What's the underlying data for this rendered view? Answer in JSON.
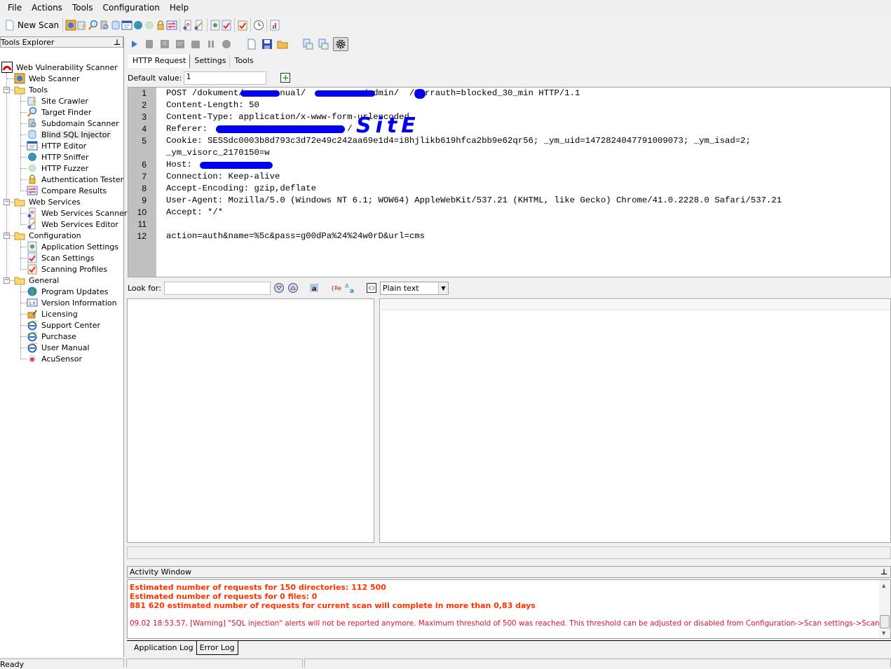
{
  "menu": [
    "File",
    "Actions",
    "Tools",
    "Configuration",
    "Help"
  ],
  "toolbar": {
    "new_scan_label": "New Scan",
    "icons": [
      "web-scanner-icon",
      "site-crawler-icon",
      "target-finder-icon",
      "subdomain-scanner-icon",
      "blind-sql-icon",
      "http-editor-icon",
      "http-sniffer-icon",
      "http-fuzzer-icon",
      "authentication-tester-icon",
      "compare-results-icon",
      "web-services-scanner-icon",
      "web-services-editor-icon",
      "application-settings-icon",
      "scan-settings-icon",
      "scanning-profiles-icon",
      "scheduler-icon",
      "reporter-icon"
    ]
  },
  "explorer": {
    "title": "Tools Explorer",
    "pin": "⫪",
    "root": "Web Vulnerability Scanner",
    "items": [
      {
        "label": "Web Scanner",
        "level": 1,
        "icon": "web-scanner-icon"
      },
      {
        "label": "Tools",
        "level": 1,
        "icon": "folder-icon",
        "group": true
      },
      {
        "label": "Site Crawler",
        "level": 2,
        "icon": "site-crawler-icon"
      },
      {
        "label": "Target Finder",
        "level": 2,
        "icon": "target-finder-icon"
      },
      {
        "label": "Subdomain Scanner",
        "level": 2,
        "icon": "subdomain-scanner-icon"
      },
      {
        "label": "Blind SQL Injector",
        "level": 2,
        "icon": "blind-sql-icon",
        "selected": true
      },
      {
        "label": "HTTP Editor",
        "level": 2,
        "icon": "http-editor-icon"
      },
      {
        "label": "HTTP Sniffer",
        "level": 2,
        "icon": "http-sniffer-icon"
      },
      {
        "label": "HTTP Fuzzer",
        "level": 2,
        "icon": "http-fuzzer-icon"
      },
      {
        "label": "Authentication Tester",
        "level": 2,
        "icon": "lock-icon"
      },
      {
        "label": "Compare Results",
        "level": 2,
        "icon": "compare-results-icon"
      },
      {
        "label": "Web Services",
        "level": 1,
        "icon": "folder-icon",
        "group": true
      },
      {
        "label": "Web Services Scanner",
        "level": 2,
        "icon": "web-services-scanner-icon"
      },
      {
        "label": "Web Services Editor",
        "level": 2,
        "icon": "web-services-editor-icon"
      },
      {
        "label": "Configuration",
        "level": 1,
        "icon": "folder-icon",
        "group": true
      },
      {
        "label": "Application Settings",
        "level": 2,
        "icon": "application-settings-icon"
      },
      {
        "label": "Scan Settings",
        "level": 2,
        "icon": "scan-settings-icon"
      },
      {
        "label": "Scanning Profiles",
        "level": 2,
        "icon": "scanning-profiles-icon"
      },
      {
        "label": "General",
        "level": 1,
        "icon": "folder-icon",
        "group": true
      },
      {
        "label": "Program Updates",
        "level": 2,
        "icon": "program-updates-icon"
      },
      {
        "label": "Version Information",
        "level": 2,
        "icon": "version-info-icon"
      },
      {
        "label": "Licensing",
        "level": 2,
        "icon": "licensing-icon"
      },
      {
        "label": "Support Center",
        "level": 2,
        "icon": "ie-icon"
      },
      {
        "label": "Purchase",
        "level": 2,
        "icon": "ie-icon"
      },
      {
        "label": "User Manual",
        "level": 2,
        "icon": "ie-icon"
      },
      {
        "label": "AcuSensor",
        "level": 2,
        "icon": "acusensor-icon"
      }
    ]
  },
  "tool": {
    "tabs": [
      {
        "label": "HTTP Request",
        "active": true
      },
      {
        "label": "Settings",
        "active": false
      },
      {
        "label": "Tools",
        "active": false
      }
    ],
    "default_value_label": "Default value:",
    "default_value": "1",
    "request_lines": [
      {
        "n": "1",
        "text": "POST /dokument/     manual/           /admin/  /?errauth=blocked_30_min HTTP/1.1"
      },
      {
        "n": "2",
        "text": "Content-Length: 50"
      },
      {
        "n": "3",
        "text": "Content-Type: application/x-www-form-urlencoded"
      },
      {
        "n": "4",
        "text": "Referer:                           /"
      },
      {
        "n": "5",
        "text": "Cookie: SESSdc0003b8d793c3d72e49c242aa69e1d4=i8hjlikb619hfca2bb9e62qr56; _ym_uid=1472824047791009073; _ym_isad=2;"
      },
      {
        "n": "",
        "text": "_ym_visorc_2170150=w"
      },
      {
        "n": "6",
        "text": "Host:            "
      },
      {
        "n": "7",
        "text": "Connection: Keep-alive"
      },
      {
        "n": "8",
        "text": "Accept-Encoding: gzip,deflate"
      },
      {
        "n": "9",
        "text": "User-Agent: Mozilla/5.0 (Windows NT 6.1; WOW64) AppleWebKit/537.21 (KHTML, like Gecko) Chrome/41.0.2228.0 Safari/537.21"
      },
      {
        "n": "10",
        "text": "Accept: */*"
      },
      {
        "n": "11",
        "text": ""
      },
      {
        "n": "12",
        "text": "action=auth&name=%5c&pass=g00dPa%24%24w0rD&url=cms"
      }
    ],
    "annotation": "SitE",
    "look_for_label": "Look for:",
    "look_for_value": "",
    "search_mode": "Plain text"
  },
  "activity": {
    "title": "Activity Window",
    "lines": [
      {
        "text": "Estimated number of requests for 150 directories: 112 500",
        "style": "bold"
      },
      {
        "text": "Estimated number of requests for 0 files: 0",
        "style": "bold"
      },
      {
        "text": "881 620 estimated number of requests for current scan will complete in more than 0,83 days",
        "style": "bold"
      },
      {
        "text": "09.02 18:53.57, [Warning] \"SQL injection\" alerts will not be reported anymore. Maximum threshold of 500 was reached. This threshold can be adjusted or disabled from Configuration->Scan settings->Scanning Options.",
        "style": "warn"
      }
    ],
    "tabs": [
      {
        "label": "Application Log",
        "active": false
      },
      {
        "label": "Error Log",
        "active": true
      }
    ]
  },
  "status": {
    "text": "Ready"
  },
  "colors": {
    "log_bold": "#ff3300",
    "log_warning": "#e8102a",
    "redaction": "#0000ee",
    "gutter": "#c0c0c0"
  }
}
